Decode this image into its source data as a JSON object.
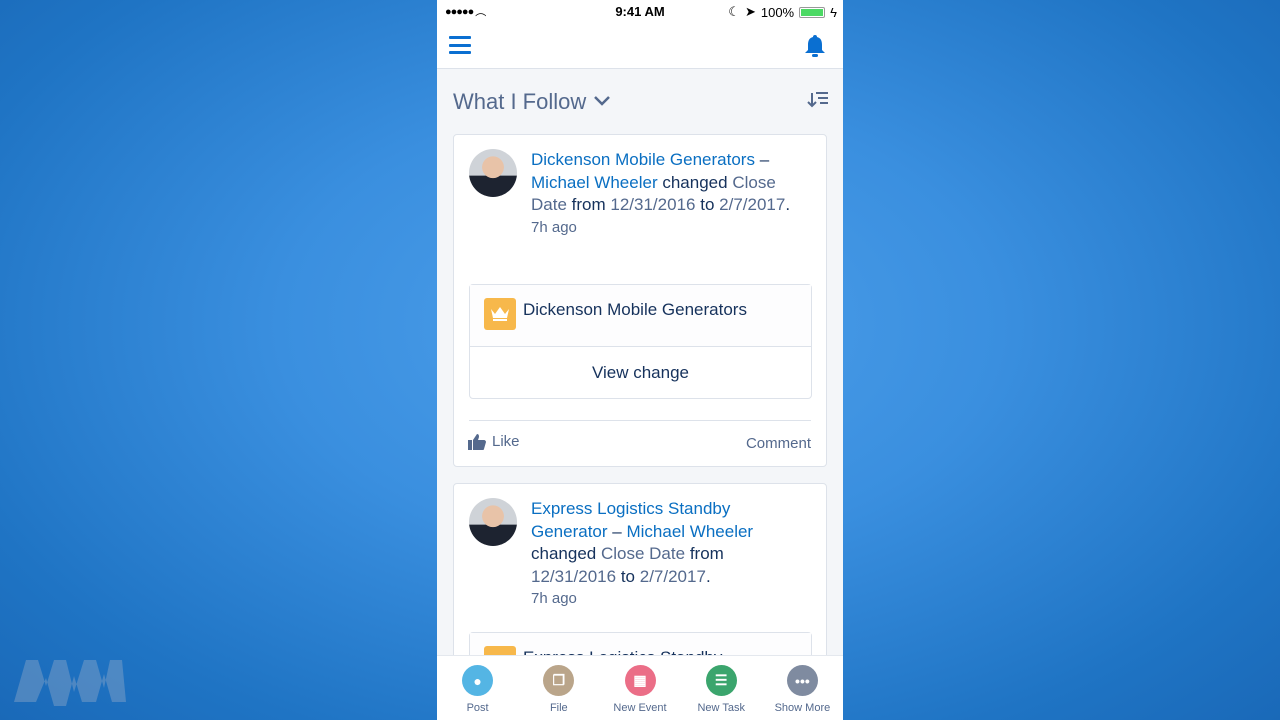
{
  "watermark": "MWM",
  "status": {
    "time": "9:41 AM",
    "battery": "100%",
    "battery_level": 100
  },
  "header": {
    "menu_icon": "hamburger-icon",
    "bell_icon": "bell-icon"
  },
  "feed": {
    "title": "What I Follow",
    "sort_icon": "sort-icon"
  },
  "posts": [
    {
      "record": "Dickenson Mobile Generators",
      "dash": "–",
      "user": "Michael Wheeler",
      "changed": "changed",
      "field": "Close Date",
      "from": "from",
      "old": "12/31/2016",
      "to": "to",
      "new": "2/7/2017",
      "period": ".",
      "ago": "7h ago",
      "record_card": "Dickenson Mobile Generators",
      "view_change": "View change",
      "like": "Like",
      "comment": "Comment"
    },
    {
      "record": "Express Logistics Standby Generator",
      "dash": "–",
      "user": "Michael Wheeler",
      "changed": "changed",
      "field": "Close Date",
      "from": "from",
      "old": "12/31/2016",
      "to": "to",
      "new": "2/7/2017",
      "period": ".",
      "ago": "7h ago",
      "record_card": "Express Logistics Standby"
    }
  ],
  "tabs": [
    {
      "label": "Post",
      "color": "#54b5e4"
    },
    {
      "label": "File",
      "color": "#baa58a"
    },
    {
      "label": "New Event",
      "color": "#eb6e87"
    },
    {
      "label": "New Task",
      "color": "#3ba56d"
    },
    {
      "label": "Show More",
      "color": "#7f8ba0"
    }
  ],
  "colors": {
    "link": "#0a6fc2",
    "text": "#16325c",
    "muted": "#54698d",
    "accent": "#0a6fd1"
  }
}
